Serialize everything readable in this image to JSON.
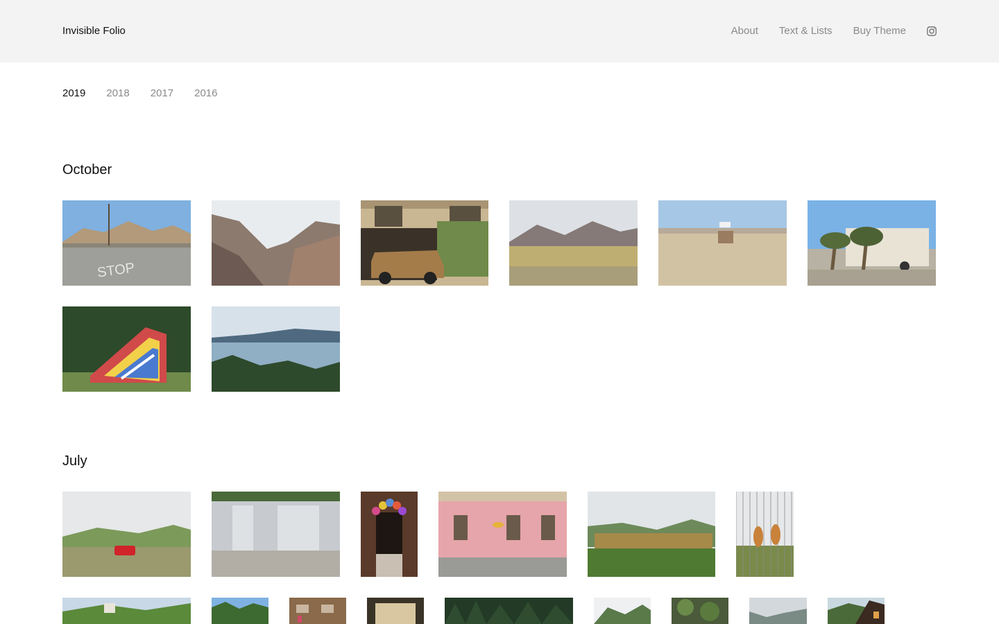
{
  "header": {
    "brand": "Invisible Folio",
    "nav": [
      {
        "label": "About"
      },
      {
        "label": "Text & Lists"
      },
      {
        "label": "Buy Theme"
      }
    ],
    "instagram_icon": "instagram-icon"
  },
  "years": [
    {
      "label": "2019",
      "active": true
    },
    {
      "label": "2018",
      "active": false
    },
    {
      "label": "2017",
      "active": false
    },
    {
      "label": "2016",
      "active": false
    }
  ],
  "sections": [
    {
      "title": "October",
      "photos": [
        {
          "name": "desert-road-stop-photo"
        },
        {
          "name": "mountain-valley-photo"
        },
        {
          "name": "old-truck-garage-photo"
        },
        {
          "name": "desert-mountains-photo"
        },
        {
          "name": "desert-sign-photo"
        },
        {
          "name": "trailer-palm-trees-photo"
        },
        {
          "name": "inflatable-slide-photo"
        },
        {
          "name": "lake-forest-photo"
        }
      ]
    },
    {
      "title": "July",
      "photos": [
        {
          "name": "red-car-hills-photo"
        },
        {
          "name": "garage-doors-photo"
        },
        {
          "name": "balloon-doorway-photo"
        },
        {
          "name": "pink-building-photo"
        },
        {
          "name": "freight-train-photo"
        },
        {
          "name": "fence-bears-photo"
        },
        {
          "name": "village-house-photo"
        },
        {
          "name": "trees-sky-photo"
        },
        {
          "name": "apartment-laundry-photo"
        },
        {
          "name": "interior-doorway-photo"
        },
        {
          "name": "dark-forest-photo"
        },
        {
          "name": "green-mountains-photo"
        },
        {
          "name": "ivy-wall-photo"
        },
        {
          "name": "misty-valley-photo"
        },
        {
          "name": "wooden-house-photo"
        }
      ]
    }
  ]
}
